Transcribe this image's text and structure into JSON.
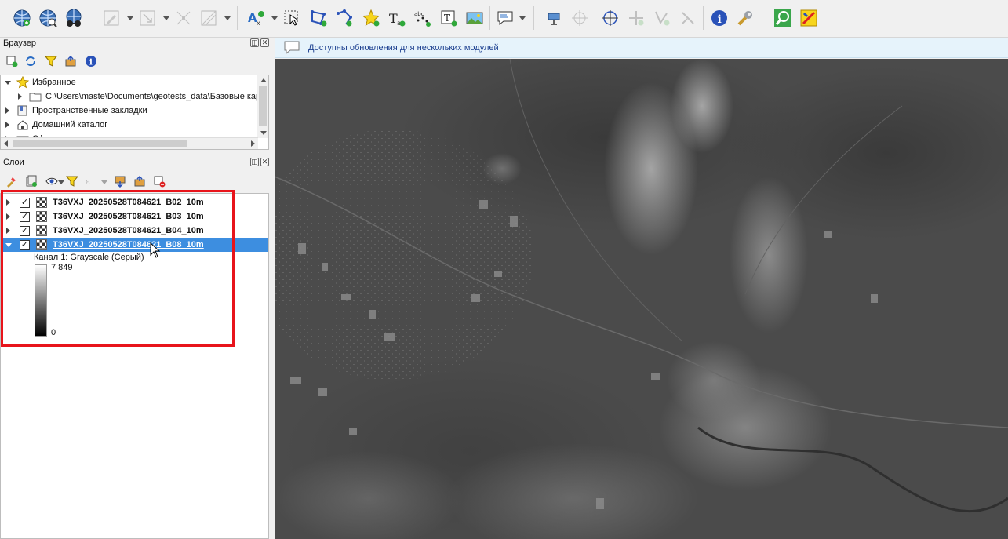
{
  "toolbar": {
    "buttons": [
      "add-wms-layer-icon",
      "add-wcs-layer-icon",
      "add-wfs-layer-icon",
      "digitize-pencil-icon",
      "digitize-move-icon",
      "node-tool-icon",
      "vertex-tool-icon",
      "label-tool-icon",
      "select-feature-icon",
      "add-polygon-icon",
      "reshape-icon",
      "star-icon",
      "text-annotation-icon",
      "point-labels-icon",
      "text-box-icon",
      "image-icon",
      "form-annotation-icon",
      "move-annotation-icon",
      "pan-target-icon",
      "globe-icon",
      "offset-icon",
      "check-geometry-icon",
      "topology-icon",
      "info-icon",
      "wrench-icon",
      "search-icon",
      "plugin-icon"
    ]
  },
  "browser": {
    "title": "Браузер",
    "items": [
      {
        "label": "Избранное",
        "icon": "star-icon"
      },
      {
        "label": "C:\\Users\\maste\\Documents\\geotests_data\\Базовые карт",
        "icon": "folder-icon"
      },
      {
        "label": "Пространственные закладки",
        "icon": "bookmark-icon"
      },
      {
        "label": "Домашний каталог",
        "icon": "home-icon"
      },
      {
        "label": "C:\\",
        "icon": "drive-icon"
      }
    ]
  },
  "layers": {
    "title": "Слои",
    "items": [
      {
        "label": "T36VXJ_20250528T084621_B02_10m",
        "checked": true,
        "selected": false
      },
      {
        "label": "T36VXJ_20250528T084621_B03_10m",
        "checked": true,
        "selected": false
      },
      {
        "label": "T36VXJ_20250528T084621_B04_10m",
        "checked": true,
        "selected": false
      },
      {
        "label": "T36VXJ_20250528T084621_B08_10m",
        "checked": true,
        "selected": true
      }
    ],
    "legend": {
      "band": "Канал 1: Grayscale (Серый)",
      "max": "7 849",
      "min": "0"
    },
    "check_mark": "✓"
  },
  "message_bar": {
    "text": "Доступны обновления для нескольких модулей"
  },
  "colors": {
    "selection": "#3d8ee0",
    "highlight": "#e8141b",
    "message_bg": "#e6f3fb"
  }
}
